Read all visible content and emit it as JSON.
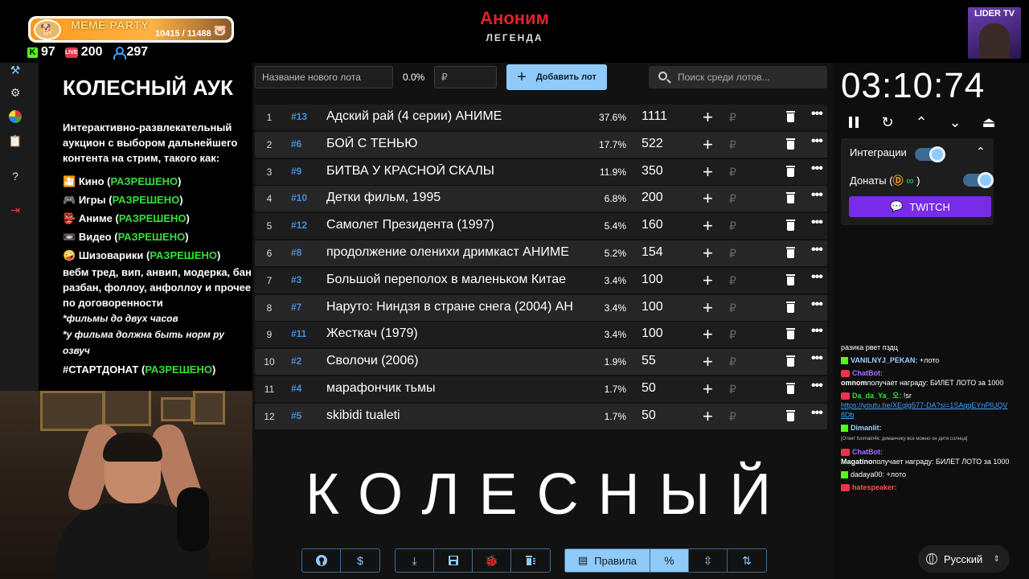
{
  "overlay": {
    "brand_name": "MEME PARTY",
    "brand_count": "10415 / 11488",
    "kick_count": "97",
    "live_count": "200",
    "viewers": "297",
    "title": "Аноним",
    "subtitle": "ЛЕГЕНДА",
    "cam_label": "LIDER TV"
  },
  "description": {
    "title": "КОЛЕСНЫЙ АУК",
    "intro": "Интерактивно-развлекательный аукцион с выбором дальнейшего контента на стрим, такого как:",
    "categories": [
      {
        "icon": "🎦",
        "name": "Кино",
        "status": "РАЗРЕШЕНО"
      },
      {
        "icon": "🎮",
        "name": "Игры",
        "status": "РАЗРЕШЕНО"
      },
      {
        "icon": "👺",
        "name": "Аниме",
        "status": "РАЗРЕШЕНО"
      },
      {
        "icon": "📼",
        "name": "Видео",
        "status": "РАЗРЕШЕНО"
      },
      {
        "icon": "🤪",
        "name": "Шизоварики",
        "status": "РАЗРЕШЕНО"
      }
    ],
    "extra": "вебм тред, вип, анвип, модерка, бан разбан, фоллоу, анфоллоу и прочее по договоренности",
    "note1": "*фильмы до двух часов",
    "note2": "*у фильма должна быть норм ру озвуч",
    "hashtag": "#СТАРТДОНАТ",
    "hashtag_status": "РАЗРЕШЕНО"
  },
  "controls": {
    "new_lot_placeholder": "Название нового лота",
    "percent": "0.0%",
    "sum_placeholder": "₽",
    "add_label": "Добавить лот",
    "search_placeholder": "Поиск среди лотов..."
  },
  "lots": [
    {
      "n": "1",
      "id": "#13",
      "name": " Адский рай (4 серии) АНИМЕ",
      "pct": "37.6%",
      "amount": "1111"
    },
    {
      "n": "2",
      "id": "#6",
      "name": "БОЙ С ТЕНЬЮ",
      "pct": "17.7%",
      "amount": "522"
    },
    {
      "n": "3",
      "id": "#9",
      "name": "БИТВА У КРАСНОЙ СКАЛЫ",
      "pct": "11.9%",
      "amount": "350"
    },
    {
      "n": "4",
      "id": "#10",
      "name": " Детки фильм, 1995",
      "pct": "6.8%",
      "amount": "200"
    },
    {
      "n": "5",
      "id": "#12",
      "name": " Самолет Президента (1997)",
      "pct": "5.4%",
      "amount": "160"
    },
    {
      "n": "6",
      "id": "#8",
      "name": "продолжение оленихи дримкаст АНИМЕ",
      "pct": "5.2%",
      "amount": "154"
    },
    {
      "n": "7",
      "id": "#3",
      "name": "Большой переполох в маленьком Китае",
      "pct": "3.4%",
      "amount": "100"
    },
    {
      "n": "8",
      "id": "#7",
      "name": "Наруто: Ниндзя в стране снега (2004) АН",
      "pct": "3.4%",
      "amount": "100"
    },
    {
      "n": "9",
      "id": "#11",
      "name": " Жесткач (1979)",
      "pct": "3.4%",
      "amount": "100"
    },
    {
      "n": "10",
      "id": "#2",
      "name": "Сволочи (2006)",
      "pct": "1.9%",
      "amount": "55"
    },
    {
      "n": "11",
      "id": "#4",
      "name": "марафончик тьмы",
      "pct": "1.7%",
      "amount": "50"
    },
    {
      "n": "12",
      "id": "#5",
      "name": "skibidi tualeti",
      "pct": "1.7%",
      "amount": "50"
    }
  ],
  "rub_symbol": "₽",
  "wheel_title": "КОЛЕСНЫЙ",
  "toolbar": {
    "rules_label": "Правила",
    "percent_label": "%"
  },
  "timer": {
    "value": "03:10:74"
  },
  "integrations": {
    "title": "Интеграции",
    "donations": "Донаты (",
    "donations_end": ")",
    "twitch_label": "TWITCH"
  },
  "chat": {
    "m0": "разика рвет пздц",
    "m1_user": "VANILNYJ_PEKAN:",
    "m1_text": " +лото",
    "m2_user": "ChatBot:",
    "m2_text_user": "omnom",
    "m2_text": "получает награду: БИЛЕТ ЛОТО за 1000",
    "m3_user": "Da_da_Ya_ 오:",
    "m3_text": " !sr",
    "m3_link": "https://youtu.be/XEqlg577-DA?si=1SAqqEYnPIUQV8Db",
    "m4_user": "Dimanlit:",
    "m4_small": "[Ответ funmain4k: диманчику все можно он дитя солнца]",
    "m5_user": "ChatBot:",
    "m5_text_user": "Magatino",
    "m5_text": "получает награду: БИЛЕТ ЛОТО за 1000",
    "m6_user": "dadaya00:",
    "m6_text": " +лото",
    "m7_user": "hatespeaker:"
  },
  "language": "Русский"
}
